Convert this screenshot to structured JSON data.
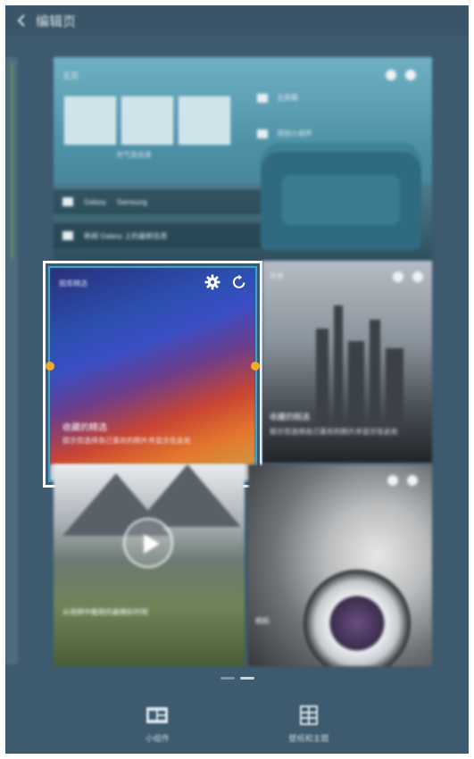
{
  "topbar": {
    "title": "编辑页"
  },
  "widgets": {
    "home": {
      "header": "主页",
      "sub": "天气及信息",
      "right_rows": [
        "主屏幕",
        "添加小组件"
      ],
      "strip1_title": "Galaxy",
      "strip1_sub": "Samsung",
      "strip2": "新闻 Galaxy 上的最新信息"
    },
    "gallery": {
      "label": "图库精选",
      "caption_title": "收藏的精选",
      "caption_sub": "提示您选择自己喜欢的照片并显示在此处"
    },
    "city": {
      "label": "风景",
      "caption_title": "收藏的精选",
      "caption_sub": "提示您选择自己喜欢的照片并显示在此处"
    },
    "video": {
      "caption": "从视频中截取的最精彩时刻"
    },
    "camera": {
      "caption": "相机"
    }
  },
  "pager": {
    "pages": 2,
    "active": 1
  },
  "bottom_bar": {
    "items": [
      {
        "label": "小组件",
        "icon": "widgets-icon"
      },
      {
        "label": "壁纸和主题",
        "icon": "grid-icon"
      }
    ]
  }
}
